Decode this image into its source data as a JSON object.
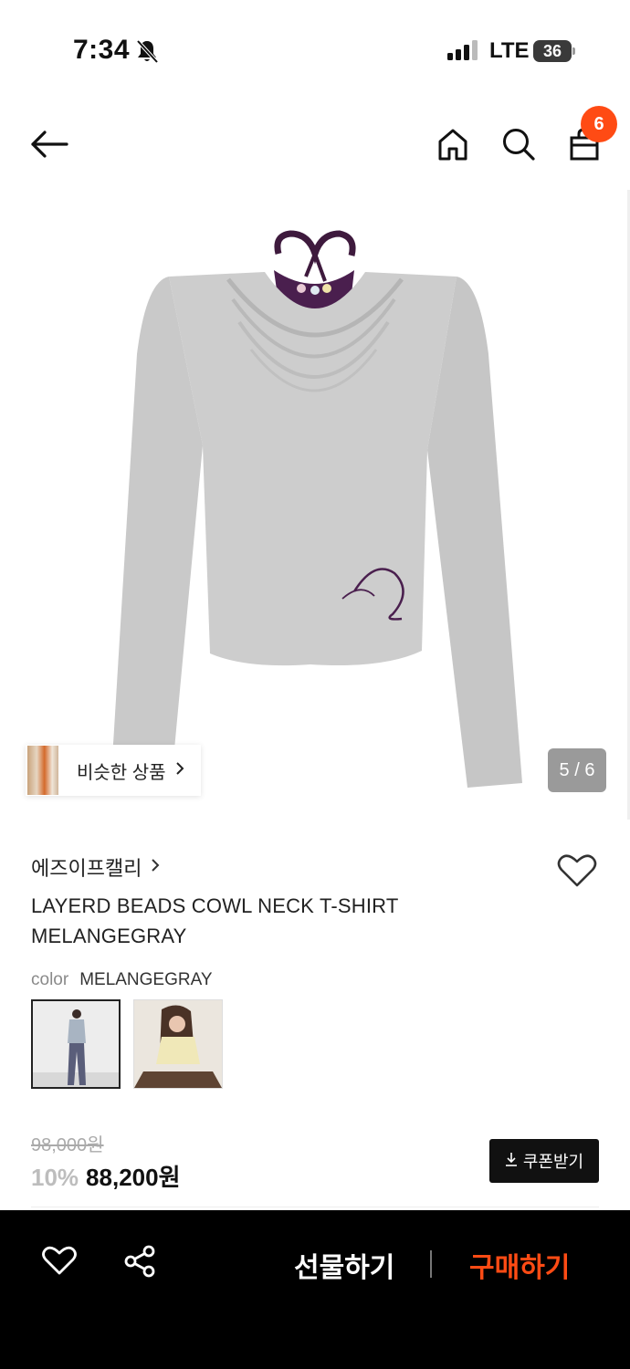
{
  "status_bar": {
    "time": "7:34",
    "network": "LTE",
    "battery": "36"
  },
  "header": {
    "cart_count": "6"
  },
  "gallery": {
    "similar_label": "비슷한 상품",
    "page_indicator": "5 / 6"
  },
  "product": {
    "brand": "에즈이프캘리",
    "title": "LAYERD BEADS COWL NECK T-SHIRT MELANGEGRAY",
    "color_label": "color",
    "color_value": "MELANGEGRAY",
    "original_price": "98,000원",
    "discount": "10%",
    "price": "88,200원",
    "coupon_label": "쿠폰받기"
  },
  "bottom_bar": {
    "gift_label": "선물하기",
    "buy_label": "구매하기"
  },
  "colors": {
    "accent": "#ff4b14",
    "bottom_bar_bg": "#000000"
  },
  "icons": [
    "bell-off-icon",
    "signal-icon",
    "battery-icon",
    "back-arrow-icon",
    "home-icon",
    "search-icon",
    "shopping-bag-icon",
    "heart-icon",
    "share-icon",
    "download-icon",
    "chevron-right-icon"
  ]
}
